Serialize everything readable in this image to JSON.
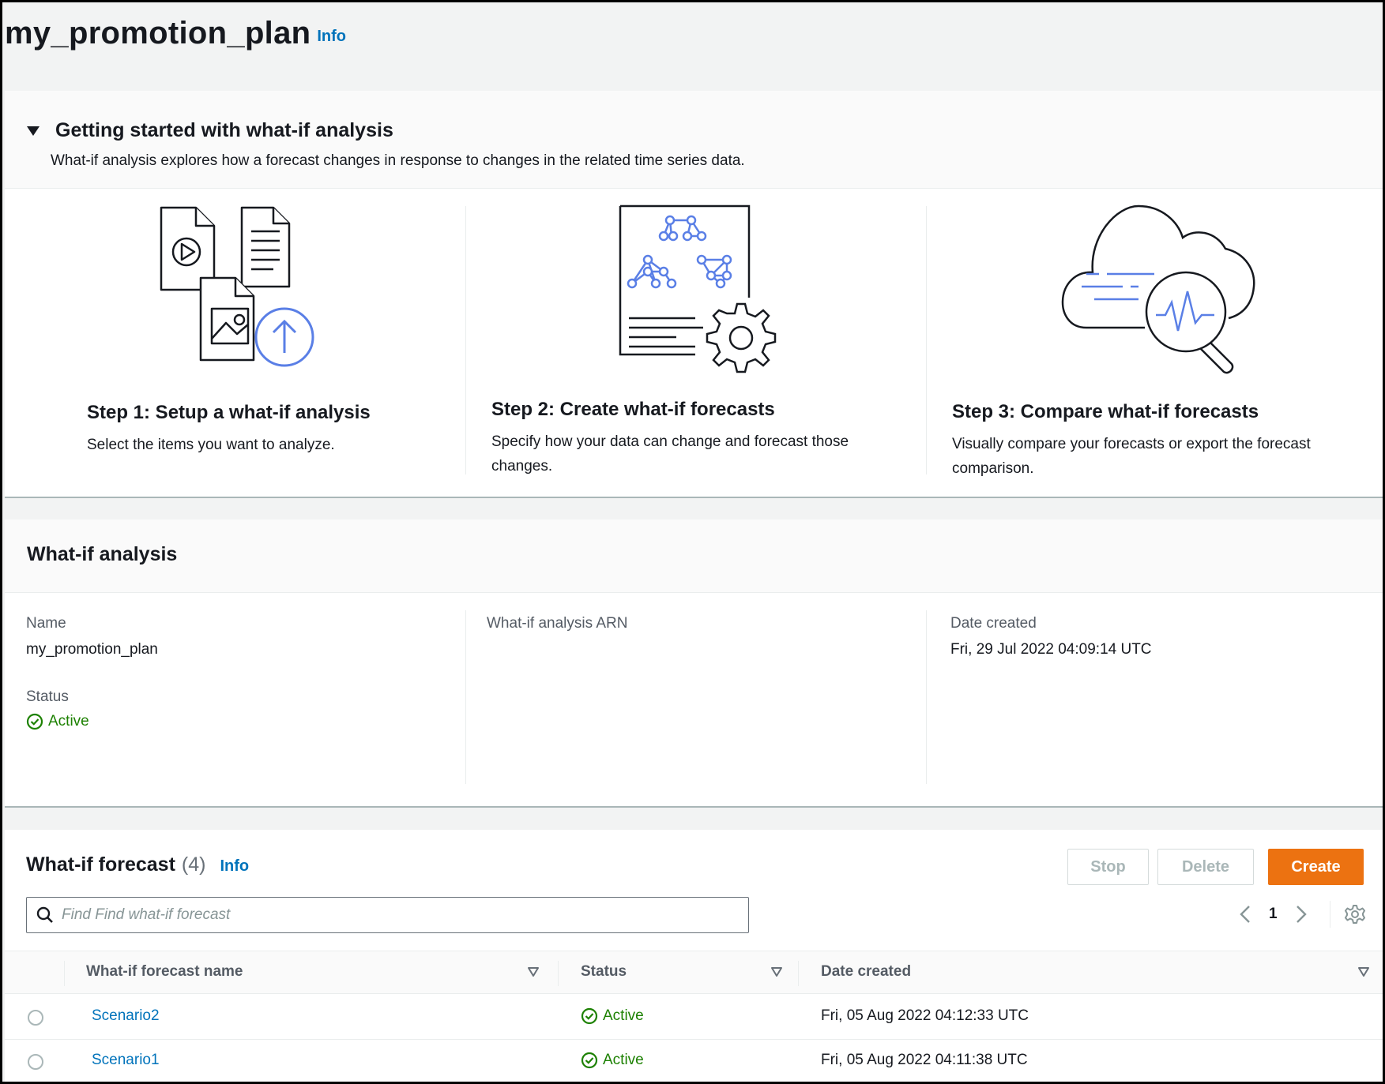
{
  "header": {
    "title": "my_promotion_plan",
    "info_label": "Info"
  },
  "getting_started": {
    "title": "Getting started with what-if analysis",
    "description": "What-if analysis explores how a forecast changes in response to changes in the related time series data.",
    "steps": [
      {
        "title": "Step 1: Setup a what-if analysis",
        "description": "Select the items you want to analyze."
      },
      {
        "title": "Step 2: Create what-if forecasts",
        "description": "Specify how your data can change and forecast those changes."
      },
      {
        "title": "Step 3: Compare what-if forecasts",
        "description": "Visually compare your forecasts or export the forecast comparison."
      }
    ]
  },
  "analysis": {
    "title": "What-if analysis",
    "name_label": "Name",
    "name_value": "my_promotion_plan",
    "status_label": "Status",
    "status_value": "Active",
    "arn_label": "What-if analysis ARN",
    "date_label": "Date created",
    "date_value": "Fri, 29 Jul 2022 04:09:14 UTC"
  },
  "forecasts": {
    "title": "What-if forecast",
    "count": "(4)",
    "info_label": "Info",
    "stop_label": "Stop",
    "delete_label": "Delete",
    "create_label": "Create",
    "search_placeholder": "Find Find what-if forecast",
    "page": "1",
    "columns": {
      "name": "What-if forecast name",
      "status": "Status",
      "date": "Date created"
    },
    "rows": [
      {
        "name": "Scenario2",
        "status": "Active",
        "date": "Fri, 05 Aug 2022 04:12:33 UTC"
      },
      {
        "name": "Scenario1",
        "status": "Active",
        "date": "Fri, 05 Aug 2022 04:11:38 UTC"
      }
    ]
  },
  "colors": {
    "accent": "#ec7211",
    "link": "#0073bb",
    "success": "#1d8102",
    "illustration_blue": "#5a7fe6"
  }
}
